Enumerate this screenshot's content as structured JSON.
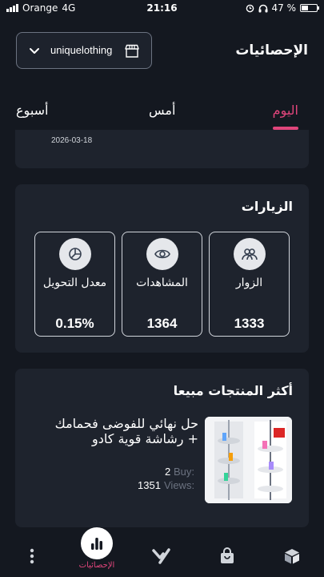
{
  "status_bar": {
    "carrier": "Orange",
    "network": "4G",
    "time": "21:16",
    "battery": "47 %",
    "battery_level": 0.47
  },
  "header": {
    "store_name": "uniquelothing",
    "page_title": "الإحصائيات"
  },
  "tabs": [
    {
      "label": "اليوم",
      "active": true
    },
    {
      "label": "أمس",
      "active": false
    },
    {
      "label": "أسبوع",
      "active": false
    }
  ],
  "date_card": {
    "date": "2026-03-18"
  },
  "visits": {
    "title": "الزيارات",
    "stats": [
      {
        "label": "الزوار",
        "value": "1333",
        "icon": "users-icon"
      },
      {
        "label": "المشاهدات",
        "value": "1364",
        "icon": "eye-icon"
      },
      {
        "label": "معدل التحويل",
        "value": "0.15%",
        "icon": "pie-chart-icon"
      }
    ]
  },
  "top_products": {
    "title": "أكثر المنتجات مبيعا",
    "items": [
      {
        "name": "حل نهائي للفوضى فحمامك + رشاشة قوية كادو",
        "buy_label": "Buy:",
        "buy_value": "2",
        "views_label": "Views:",
        "views_value": "1351"
      }
    ]
  },
  "bottom_nav": {
    "active_label": "الإحصائيات",
    "items": [
      "more-icon",
      "statistics-icon",
      "brand-logo-icon",
      "shopping-bag-icon",
      "box-icon"
    ]
  },
  "colors": {
    "background": "#141820",
    "card": "#1e232d",
    "accent": "#e0457b"
  }
}
